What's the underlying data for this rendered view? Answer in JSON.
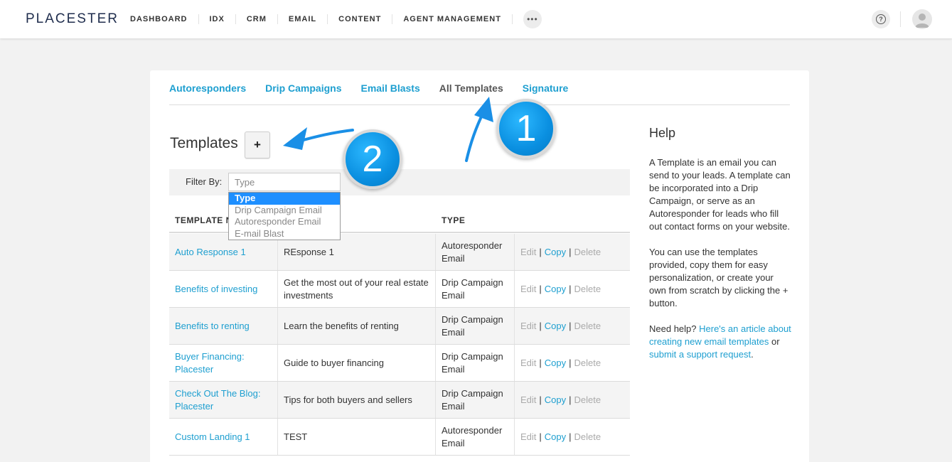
{
  "app": {
    "logo": "PLACESTER"
  },
  "nav": [
    "DASHBOARD",
    "IDX",
    "CRM",
    "EMAIL",
    "CONTENT",
    "AGENT MANAGEMENT"
  ],
  "more_label": "•••",
  "help_glyph": "?",
  "tabs": [
    {
      "label": "Autoresponders",
      "active": false
    },
    {
      "label": "Drip Campaigns",
      "active": false
    },
    {
      "label": "Email Blasts",
      "active": false
    },
    {
      "label": "All Templates",
      "active": true
    },
    {
      "label": "Signature",
      "active": false
    }
  ],
  "templates": {
    "title": "Templates",
    "add_label": "+",
    "filter_label": "Filter By:",
    "filter_placeholder": "Type",
    "filter_options": [
      "Type",
      "Drip Campaign Email",
      "Autoresponder Email",
      "E-mail Blast"
    ],
    "columns": {
      "name": "TEMPLATE NAME",
      "type": "TYPE"
    },
    "rows": [
      {
        "name": "Auto Response 1",
        "subject": "REsponse 1",
        "type": "Autoresponder Email"
      },
      {
        "name": "Benefits of investing",
        "subject": "Get the most out of your real estate investments",
        "type": "Drip Campaign Email"
      },
      {
        "name": "Benefits to renting",
        "subject": "Learn the benefits of renting",
        "type": "Drip Campaign Email"
      },
      {
        "name": "Buyer Financing: Placester",
        "subject": "Guide to buyer financing",
        "type": "Drip Campaign Email"
      },
      {
        "name": "Check Out The Blog: Placester",
        "subject": "Tips for both buyers and sellers",
        "type": "Drip Campaign Email"
      },
      {
        "name": "Custom Landing 1",
        "subject": "TEST",
        "type": "Autoresponder Email"
      }
    ],
    "actions": {
      "edit": "Edit",
      "copy": "Copy",
      "delete": "Delete"
    }
  },
  "help": {
    "title": "Help",
    "p1": "A Template is an email you can send to your leads. A template can be incorporated into a Drip Campaign, or serve as an Autoresponder for leads who fill out contact forms on your website.",
    "p2": "You can use the templates provided, copy them for easy personalization, or create your own from scratch by clicking the + button.",
    "p3_prefix": "Need help?",
    "p3_link1": "Here's an article about creating new email templates",
    "p3_mid": "or",
    "p3_link2": "submit a support request",
    "p3_suffix": "."
  },
  "callouts": [
    "1",
    "2"
  ],
  "colors": {
    "accent": "#1e9fd0",
    "brand": "#1f2d4d",
    "callout": "#0a8fe0"
  }
}
